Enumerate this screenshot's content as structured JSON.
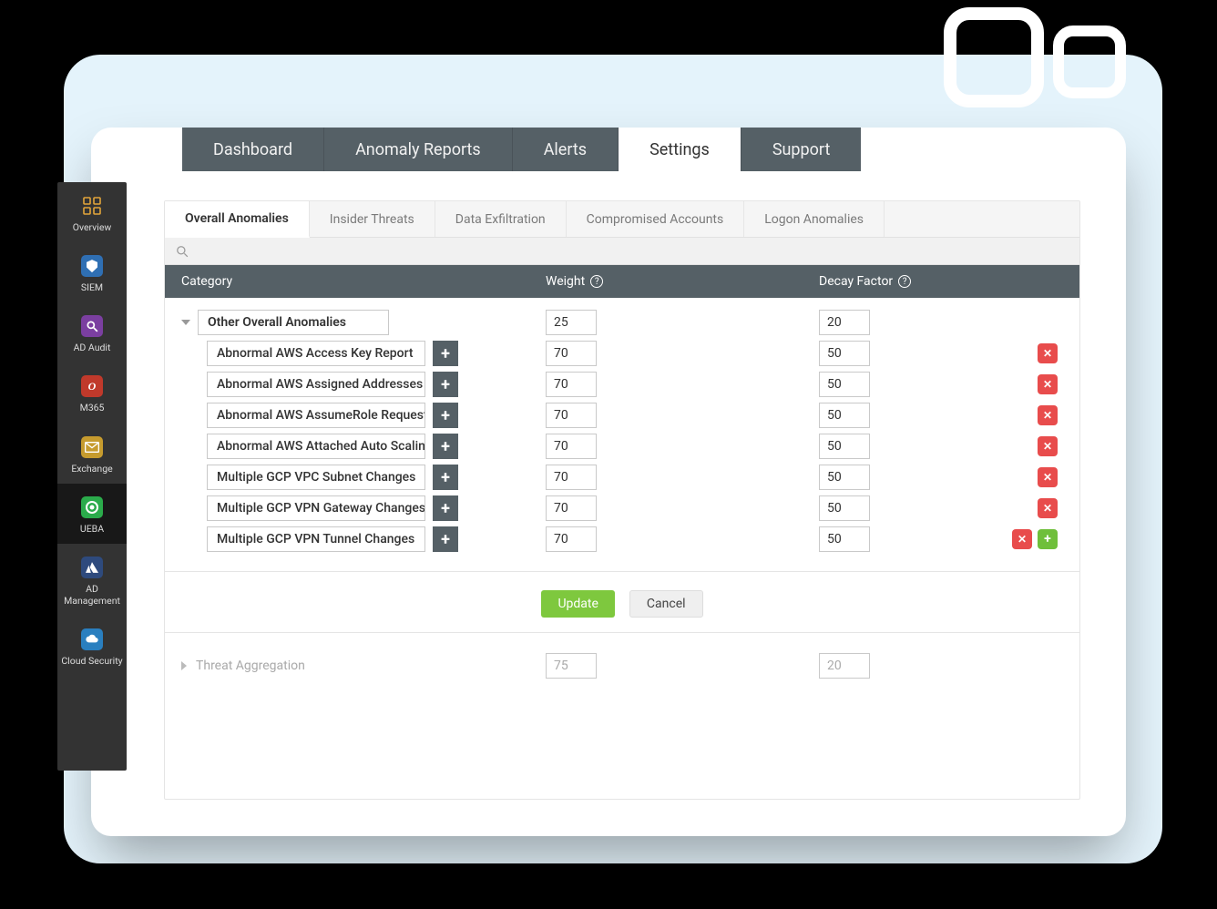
{
  "sidebar": {
    "items": [
      {
        "label": "Overview"
      },
      {
        "label": "SIEM"
      },
      {
        "label": "AD Audit"
      },
      {
        "label": "M365"
      },
      {
        "label": "Exchange"
      },
      {
        "label": "UEBA"
      },
      {
        "label": "AD Management"
      },
      {
        "label": "Cloud Security"
      }
    ],
    "active_index": 5
  },
  "top_tabs": {
    "items": [
      "Dashboard",
      "Anomaly Reports",
      "Alerts",
      "Settings",
      "Support"
    ],
    "active_index": 3
  },
  "sub_tabs": {
    "items": [
      "Overall Anomalies",
      "Insider Threats",
      "Data Exfiltration",
      "Compromised Accounts",
      "Logon Anomalies"
    ],
    "active_index": 0
  },
  "columns": {
    "category": "Category",
    "weight": "Weight",
    "decay": "Decay Factor"
  },
  "group": {
    "name": "Other Overall Anomalies",
    "weight": "25",
    "decay": "20",
    "rows": [
      {
        "name": "Abnormal AWS Access Key Report",
        "weight": "70",
        "decay": "50"
      },
      {
        "name": "Abnormal AWS Assigned Addresses",
        "weight": "70",
        "decay": "50"
      },
      {
        "name": "Abnormal AWS AssumeRole Requests",
        "weight": "70",
        "decay": "50"
      },
      {
        "name": "Abnormal AWS Attached Auto Scaling",
        "weight": "70",
        "decay": "50"
      },
      {
        "name": "Multiple GCP VPC Subnet Changes",
        "weight": "70",
        "decay": "50"
      },
      {
        "name": "Multiple GCP VPN Gateway Changes",
        "weight": "70",
        "decay": "50"
      },
      {
        "name": "Multiple GCP VPN Tunnel Changes",
        "weight": "70",
        "decay": "50"
      }
    ]
  },
  "aggregation": {
    "name": "Threat Aggregation",
    "weight": "75",
    "decay": "20"
  },
  "buttons": {
    "update": "Update",
    "cancel": "Cancel"
  },
  "m365_initial": "O",
  "colors": {
    "accent_green": "#7ec83e",
    "danger": "#e84c4c",
    "slate": "#556066"
  }
}
